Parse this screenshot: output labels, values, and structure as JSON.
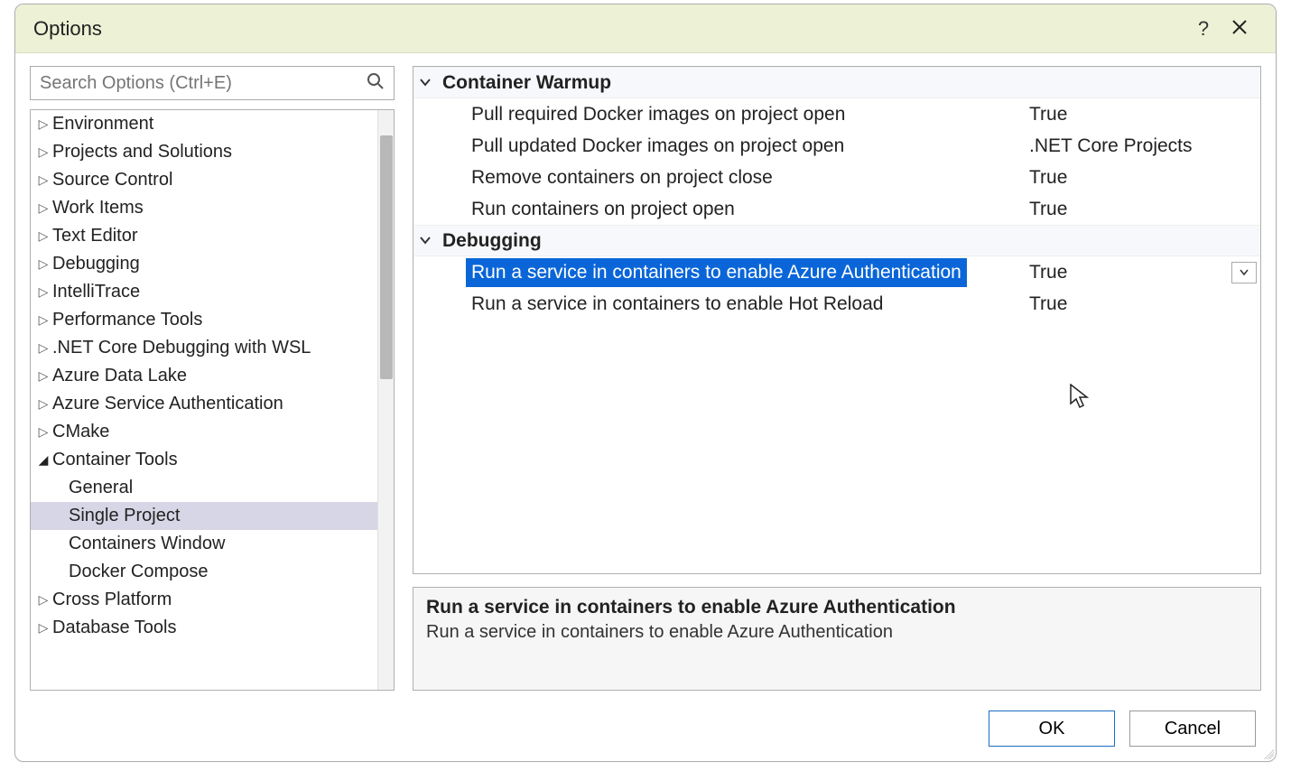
{
  "window": {
    "title": "Options",
    "help_tooltip": "?",
    "close_tooltip": "Close"
  },
  "search": {
    "placeholder": "Search Options (Ctrl+E)"
  },
  "tree": {
    "items": [
      {
        "label": "Environment",
        "level": 1,
        "expanded": false
      },
      {
        "label": "Projects and Solutions",
        "level": 1,
        "expanded": false
      },
      {
        "label": "Source Control",
        "level": 1,
        "expanded": false
      },
      {
        "label": "Work Items",
        "level": 1,
        "expanded": false
      },
      {
        "label": "Text Editor",
        "level": 1,
        "expanded": false
      },
      {
        "label": "Debugging",
        "level": 1,
        "expanded": false
      },
      {
        "label": "IntelliTrace",
        "level": 1,
        "expanded": false
      },
      {
        "label": "Performance Tools",
        "level": 1,
        "expanded": false
      },
      {
        "label": ".NET Core Debugging with WSL",
        "level": 1,
        "expanded": false
      },
      {
        "label": "Azure Data Lake",
        "level": 1,
        "expanded": false
      },
      {
        "label": "Azure Service Authentication",
        "level": 1,
        "expanded": false
      },
      {
        "label": "CMake",
        "level": 1,
        "expanded": false
      },
      {
        "label": "Container Tools",
        "level": 1,
        "expanded": true
      },
      {
        "label": "General",
        "level": 2
      },
      {
        "label": "Single Project",
        "level": 2,
        "selected": true
      },
      {
        "label": "Containers Window",
        "level": 2
      },
      {
        "label": "Docker Compose",
        "level": 2
      },
      {
        "label": "Cross Platform",
        "level": 1,
        "expanded": false
      },
      {
        "label": "Database Tools",
        "level": 1,
        "expanded": false
      }
    ]
  },
  "grid": {
    "groups": [
      {
        "name": "Container Warmup",
        "rows": [
          {
            "label": "Pull required Docker images on project open",
            "value": "True"
          },
          {
            "label": "Pull updated Docker images on project open",
            "value": ".NET Core Projects"
          },
          {
            "label": "Remove containers on project close",
            "value": "True"
          },
          {
            "label": "Run containers on project open",
            "value": "True"
          }
        ]
      },
      {
        "name": "Debugging",
        "rows": [
          {
            "label": "Run a service in containers to enable Azure Authentication",
            "value": "True",
            "selected": true,
            "hasDropdown": true
          },
          {
            "label": "Run a service in containers to enable Hot Reload",
            "value": "True"
          }
        ]
      }
    ]
  },
  "description": {
    "title": "Run a service in containers to enable Azure Authentication",
    "text": "Run a service in containers to enable Azure Authentication"
  },
  "footer": {
    "ok": "OK",
    "cancel": "Cancel"
  }
}
